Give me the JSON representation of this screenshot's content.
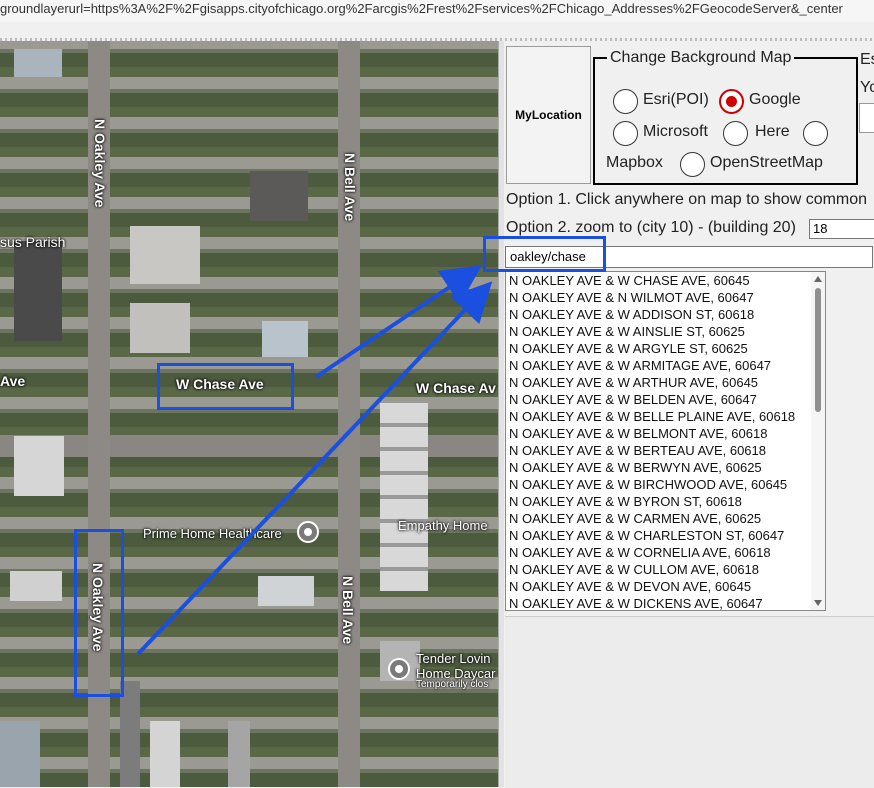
{
  "url_text": "groundlayerurl=https%3A%2F%2Fgisapps.cityofchicago.org%2Farcgis%2Frest%2Fservices%2FChicago_Addresses%2FGeocodeServer&_center",
  "map": {
    "labels": {
      "oakley_top": "N Oakley Ave",
      "oakley_bottom": "N Oakley Ave",
      "bell_top": "N Bell Ave",
      "bell_bottom": "N Bell Ave",
      "chase_left": "W Chase Ave",
      "chase_right": "W Chase Av",
      "ave_left": "Ave",
      "parish": "sus Parish",
      "prime": "Prime Home Healthcare",
      "empathy": "Empathy Home",
      "tender1": "Tender Lovin",
      "tender2": "Home Daycar",
      "tender3": "Temporarily clos"
    }
  },
  "panel": {
    "mylocation_label": "MyLocation",
    "legend": "Change Background Map",
    "radios": {
      "esri": "Esri(POI)",
      "google": "Google",
      "microsoft": "Microsoft",
      "here": "Here",
      "mapbox": "Mapbox",
      "osm": "OpenStreetMap"
    },
    "selected_radio": "google",
    "es_text": "Es",
    "yo_text": "Yo",
    "option1": "Option 1. Click anywhere on map to show common",
    "option2": "Option 2. zoom to (city 10) - (building 20)",
    "zoom_value": "18",
    "search_value": "oakley/chase",
    "results": [
      "N OAKLEY AVE & W CHASE AVE, 60645",
      "N OAKLEY AVE & N WILMOT AVE, 60647",
      "N OAKLEY AVE & W ADDISON ST, 60618",
      "N OAKLEY AVE & W AINSLIE ST, 60625",
      "N OAKLEY AVE & W ARGYLE ST, 60625",
      "N OAKLEY AVE & W ARMITAGE AVE, 60647",
      "N OAKLEY AVE & W ARTHUR AVE, 60645",
      "N OAKLEY AVE & W BELDEN AVE, 60647",
      "N OAKLEY AVE & W BELLE PLAINE AVE, 60618",
      "N OAKLEY AVE & W BELMONT AVE, 60618",
      "N OAKLEY AVE & W BERTEAU AVE, 60618",
      "N OAKLEY AVE & W BERWYN AVE, 60625",
      "N OAKLEY AVE & W BIRCHWOOD AVE, 60645",
      "N OAKLEY AVE & W BYRON ST, 60618",
      "N OAKLEY AVE & W CARMEN AVE, 60625",
      "N OAKLEY AVE & W CHARLESTON ST, 60647",
      "N OAKLEY AVE & W CORNELIA AVE, 60618",
      "N OAKLEY AVE & W CULLOM AVE, 60618",
      "N OAKLEY AVE & W DEVON AVE, 60645",
      "N OAKLEY AVE & W DICKENS AVE, 60647"
    ]
  },
  "colors": {
    "annotation_blue": "#1a4fe0",
    "radio_selected": "#d30000"
  }
}
